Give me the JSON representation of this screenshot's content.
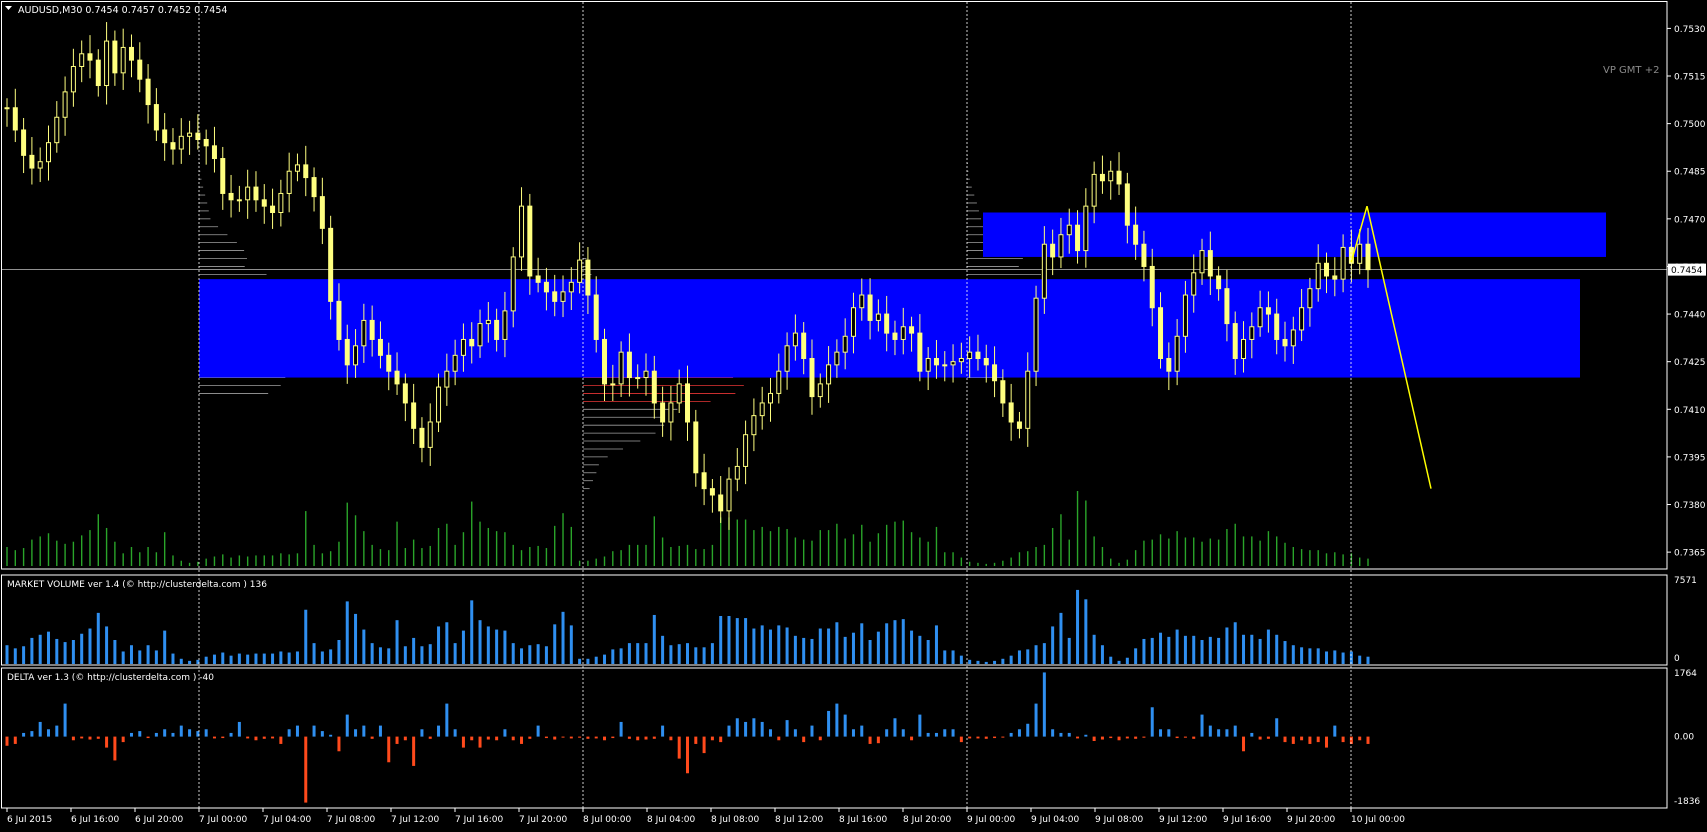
{
  "window": {
    "symbol_info": "AUDUSD,M30  0.7454 0.7457 0.7452 0.7454",
    "timezone_label": "VP GMT +2",
    "current_price_label": "0.7454"
  },
  "indicators": {
    "market_volume_label": "MARKET VOLUME ver 1.4 (© http://clusterdelta.com ) 136",
    "delta_label": "DELTA ver 1.3 (© http://clusterdelta.com ) -40"
  },
  "colors": {
    "background": "#000000",
    "candle": "#ffff80",
    "volume": "#2aa52a",
    "market_volume": "#2f8ff0",
    "delta_positive": "#2f8ff0",
    "delta_negative": "#ff4a1c",
    "zone": "#0000ff",
    "grid": "#c0c0c0",
    "projection": "#ffff00"
  },
  "chart_data": [
    {
      "type": "candlestick",
      "symbol": "AUDUSD",
      "timeframe": "M30",
      "ylim": [
        0.736,
        0.7538
      ],
      "y_ticks": [
        "0.7530",
        "0.7515",
        "0.7500",
        "0.7485",
        "0.7470",
        "0.7455",
        "0.7440",
        "0.7425",
        "0.7410",
        "0.7395",
        "0.7380",
        "0.7365"
      ],
      "x_ticks": [
        "6 Jul 2015",
        "6 Jul 16:00",
        "6 Jul 20:00",
        "7 Jul 00:00",
        "7 Jul 04:00",
        "7 Jul 08:00",
        "7 Jul 12:00",
        "7 Jul 16:00",
        "7 Jul 20:00",
        "8 Jul 00:00",
        "8 Jul 04:00",
        "8 Jul 08:00",
        "8 Jul 12:00",
        "8 Jul 16:00",
        "8 Jul 20:00",
        "9 Jul 00:00",
        "9 Jul 04:00",
        "9 Jul 08:00",
        "9 Jul 12:00",
        "9 Jul 16:00",
        "9 Jul 20:00",
        "10 Jul 00:00"
      ],
      "session_separators": [
        "7 Jul 00:00",
        "8 Jul 00:00",
        "9 Jul 00:00",
        "10 Jul 00:00"
      ],
      "current_price": 0.7454,
      "close_path": [
        0.7505,
        0.7498,
        0.749,
        0.7486,
        0.7488,
        0.7494,
        0.7502,
        0.751,
        0.7518,
        0.7522,
        0.752,
        0.7512,
        0.7526,
        0.7516,
        0.7524,
        0.752,
        0.7514,
        0.7506,
        0.7498,
        0.7494,
        0.7492,
        0.7496,
        0.7497,
        0.7495,
        0.7493,
        0.7489,
        0.7478,
        0.7476,
        0.7476,
        0.748,
        0.7476,
        0.7474,
        0.7472,
        0.7478,
        0.7485,
        0.7487,
        0.7483,
        0.7477,
        0.7467,
        0.7444,
        0.7432,
        0.7424,
        0.743,
        0.7438,
        0.7432,
        0.7427,
        0.7422,
        0.7418,
        0.7412,
        0.7404,
        0.7398,
        0.7406,
        0.7417,
        0.7422,
        0.7427,
        0.7432,
        0.743,
        0.7437,
        0.7438,
        0.7432,
        0.7441,
        0.7458,
        0.7474,
        0.7452,
        0.745,
        0.7447,
        0.7444,
        0.7447,
        0.745,
        0.7457,
        0.7446,
        0.7432,
        0.7418,
        0.7418,
        0.7428,
        0.742,
        0.742,
        0.7422,
        0.7412,
        0.7406,
        0.7412,
        0.7418,
        0.7406,
        0.739,
        0.7385,
        0.7383,
        0.7378,
        0.7388,
        0.7392,
        0.7402,
        0.7408,
        0.7412,
        0.7415,
        0.7422,
        0.743,
        0.7434,
        0.7426,
        0.7414,
        0.7418,
        0.7424,
        0.7428,
        0.7433,
        0.7442,
        0.7446,
        0.7438,
        0.744,
        0.7434,
        0.7432,
        0.7436,
        0.7434,
        0.7422,
        0.7426,
        0.7424,
        0.7424,
        0.7425,
        0.7426,
        0.7428,
        0.7426,
        0.7424,
        0.7419,
        0.7412,
        0.7406,
        0.7404,
        0.7422,
        0.7445,
        0.7462,
        0.7458,
        0.7465,
        0.7468,
        0.746,
        0.7474,
        0.7484,
        0.7482,
        0.7485,
        0.7481,
        0.7468,
        0.7462,
        0.7455,
        0.7442,
        0.7426,
        0.7422,
        0.7433,
        0.7446,
        0.7453,
        0.746,
        0.7452,
        0.7448,
        0.7437,
        0.7426,
        0.7432,
        0.7436,
        0.7442,
        0.744,
        0.7432,
        0.743,
        0.7435,
        0.7442,
        0.7448,
        0.7456,
        0.7452,
        0.7451,
        0.7461,
        0.7456,
        0.7462,
        0.7454
      ],
      "volume_profiles": [
        {
          "session": "7 Jul",
          "price_range": [
            0.7415,
            0.7505
          ],
          "poc_price": 0.7435
        },
        {
          "session": "8 Jul",
          "price_range": [
            0.7385,
            0.7458
          ],
          "poc_price": 0.742
        },
        {
          "session": "9 Jul",
          "price_range": [
            0.742,
            0.75
          ],
          "poc_price": 0.7442
        }
      ],
      "zones": [
        {
          "from": "7 Jul 00:00",
          "price_low": 0.742,
          "price_high": 0.7451
        },
        {
          "from": "9 Jul 02:00",
          "price_low": 0.7458,
          "price_high": 0.7472
        }
      ],
      "projection": [
        {
          "time": "10 Jul 00:00",
          "price": 0.7456
        },
        {
          "time": "10 Jul 01:00",
          "price": 0.7474
        },
        {
          "time": "10 Jul 05:00",
          "price": 0.7385
        }
      ]
    },
    {
      "type": "bar",
      "name": "MARKET VOLUME",
      "ylim": [
        0,
        7571
      ],
      "y_ticks": [
        "7571",
        "0"
      ],
      "values": [
        1800,
        1500,
        1700,
        2500,
        2800,
        3100,
        2400,
        2100,
        2300,
        2900,
        3400,
        4900,
        3600,
        2300,
        1200,
        1800,
        1300,
        1800,
        1300,
        3200,
        1000,
        500,
        300,
        400,
        700,
        900,
        1100,
        800,
        1000,
        900,
        1000,
        1000,
        1000,
        1200,
        1100,
        1200,
        5200,
        2000,
        1200,
        1400,
        2300,
        6000,
        4800,
        3300,
        2000,
        1600,
        1500,
        4200,
        1700,
        2500,
        1700,
        1900,
        3600,
        4000,
        2000,
        3200,
        6100,
        4200,
        3600,
        3300,
        3200,
        2000,
        1500,
        1800,
        1900,
        1700,
        3800,
        5000,
        3700,
        500,
        500,
        700,
        900,
        1400,
        1500,
        2000,
        2000,
        2000,
        4700,
        2700,
        1800,
        1900,
        2000,
        1600,
        1600,
        2000,
        4600,
        4600,
        4400,
        4400,
        3400,
        3700,
        3300,
        3700,
        3500,
        2700,
        2500,
        2400,
        3400,
        3400,
        4000,
        2600,
        3000,
        3900,
        2300,
        3100,
        3900,
        4200,
        4300,
        3200,
        2700,
        2300,
        3700,
        1300,
        1300,
        800,
        400,
        300,
        200,
        300,
        500,
        800,
        1300,
        1400,
        1800,
        2000,
        3600,
        4900,
        2500,
        7100,
        6200,
        2800,
        1800,
        700,
        300,
        600,
        1500,
        2400,
        2500,
        3000,
        2600,
        3300,
        2700,
        2700,
        2300,
        2600,
        2500,
        3500,
        4000,
        2800,
        2800,
        2400,
        3300,
        2800,
        2200,
        1800,
        1600,
        1500,
        1500,
        1200,
        1300,
        1100,
        1200,
        800,
        700,
        400,
        0,
        1300,
        1200
      ]
    },
    {
      "type": "bar",
      "name": "DELTA",
      "ylim": [
        -1836,
        1764
      ],
      "y_ticks": [
        "1764",
        "0.00",
        "-1836"
      ],
      "values": [
        -250,
        -200,
        100,
        150,
        400,
        200,
        300,
        900,
        -100,
        -50,
        -80,
        -60,
        -300,
        -650,
        -150,
        100,
        150,
        -40,
        100,
        200,
        100,
        300,
        200,
        150,
        200,
        -50,
        -40,
        100,
        400,
        -50,
        -100,
        -60,
        -50,
        -200,
        200,
        300,
        -1800,
        300,
        150,
        50,
        -400,
        600,
        200,
        300,
        -60,
        300,
        -700,
        -200,
        -100,
        -800,
        200,
        -60,
        300,
        900,
        200,
        -300,
        -100,
        -300,
        -80,
        -100,
        200,
        -100,
        -200,
        -60,
        300,
        -40,
        -80,
        -20,
        -50,
        -30,
        -60,
        -50,
        -100,
        -40,
        400,
        -60,
        -100,
        -80,
        -60,
        300,
        -100,
        -600,
        -1000,
        -200,
        -450,
        -100,
        -150,
        300,
        500,
        400,
        500,
        400,
        200,
        -100,
        450,
        200,
        -150,
        300,
        -100,
        700,
        900,
        600,
        200,
        300,
        -200,
        -180,
        200,
        500,
        200,
        -100,
        600,
        100,
        100,
        200,
        200,
        -150,
        -50,
        -50,
        -60,
        -40,
        -20,
        100,
        200,
        350,
        900,
        1750,
        200,
        100,
        100,
        -50,
        50,
        -120,
        -80,
        -40,
        -100,
        -50,
        -60,
        -30,
        800,
        200,
        200,
        -40,
        -30,
        -60,
        600,
        300,
        200,
        200,
        300,
        -400,
        100,
        -80,
        -60,
        500,
        -150,
        -200,
        -100,
        -200,
        -150,
        -300,
        300,
        -150,
        -200,
        -100,
        -200,
        50,
        -300,
        400,
        200,
        -40
      ]
    }
  ]
}
